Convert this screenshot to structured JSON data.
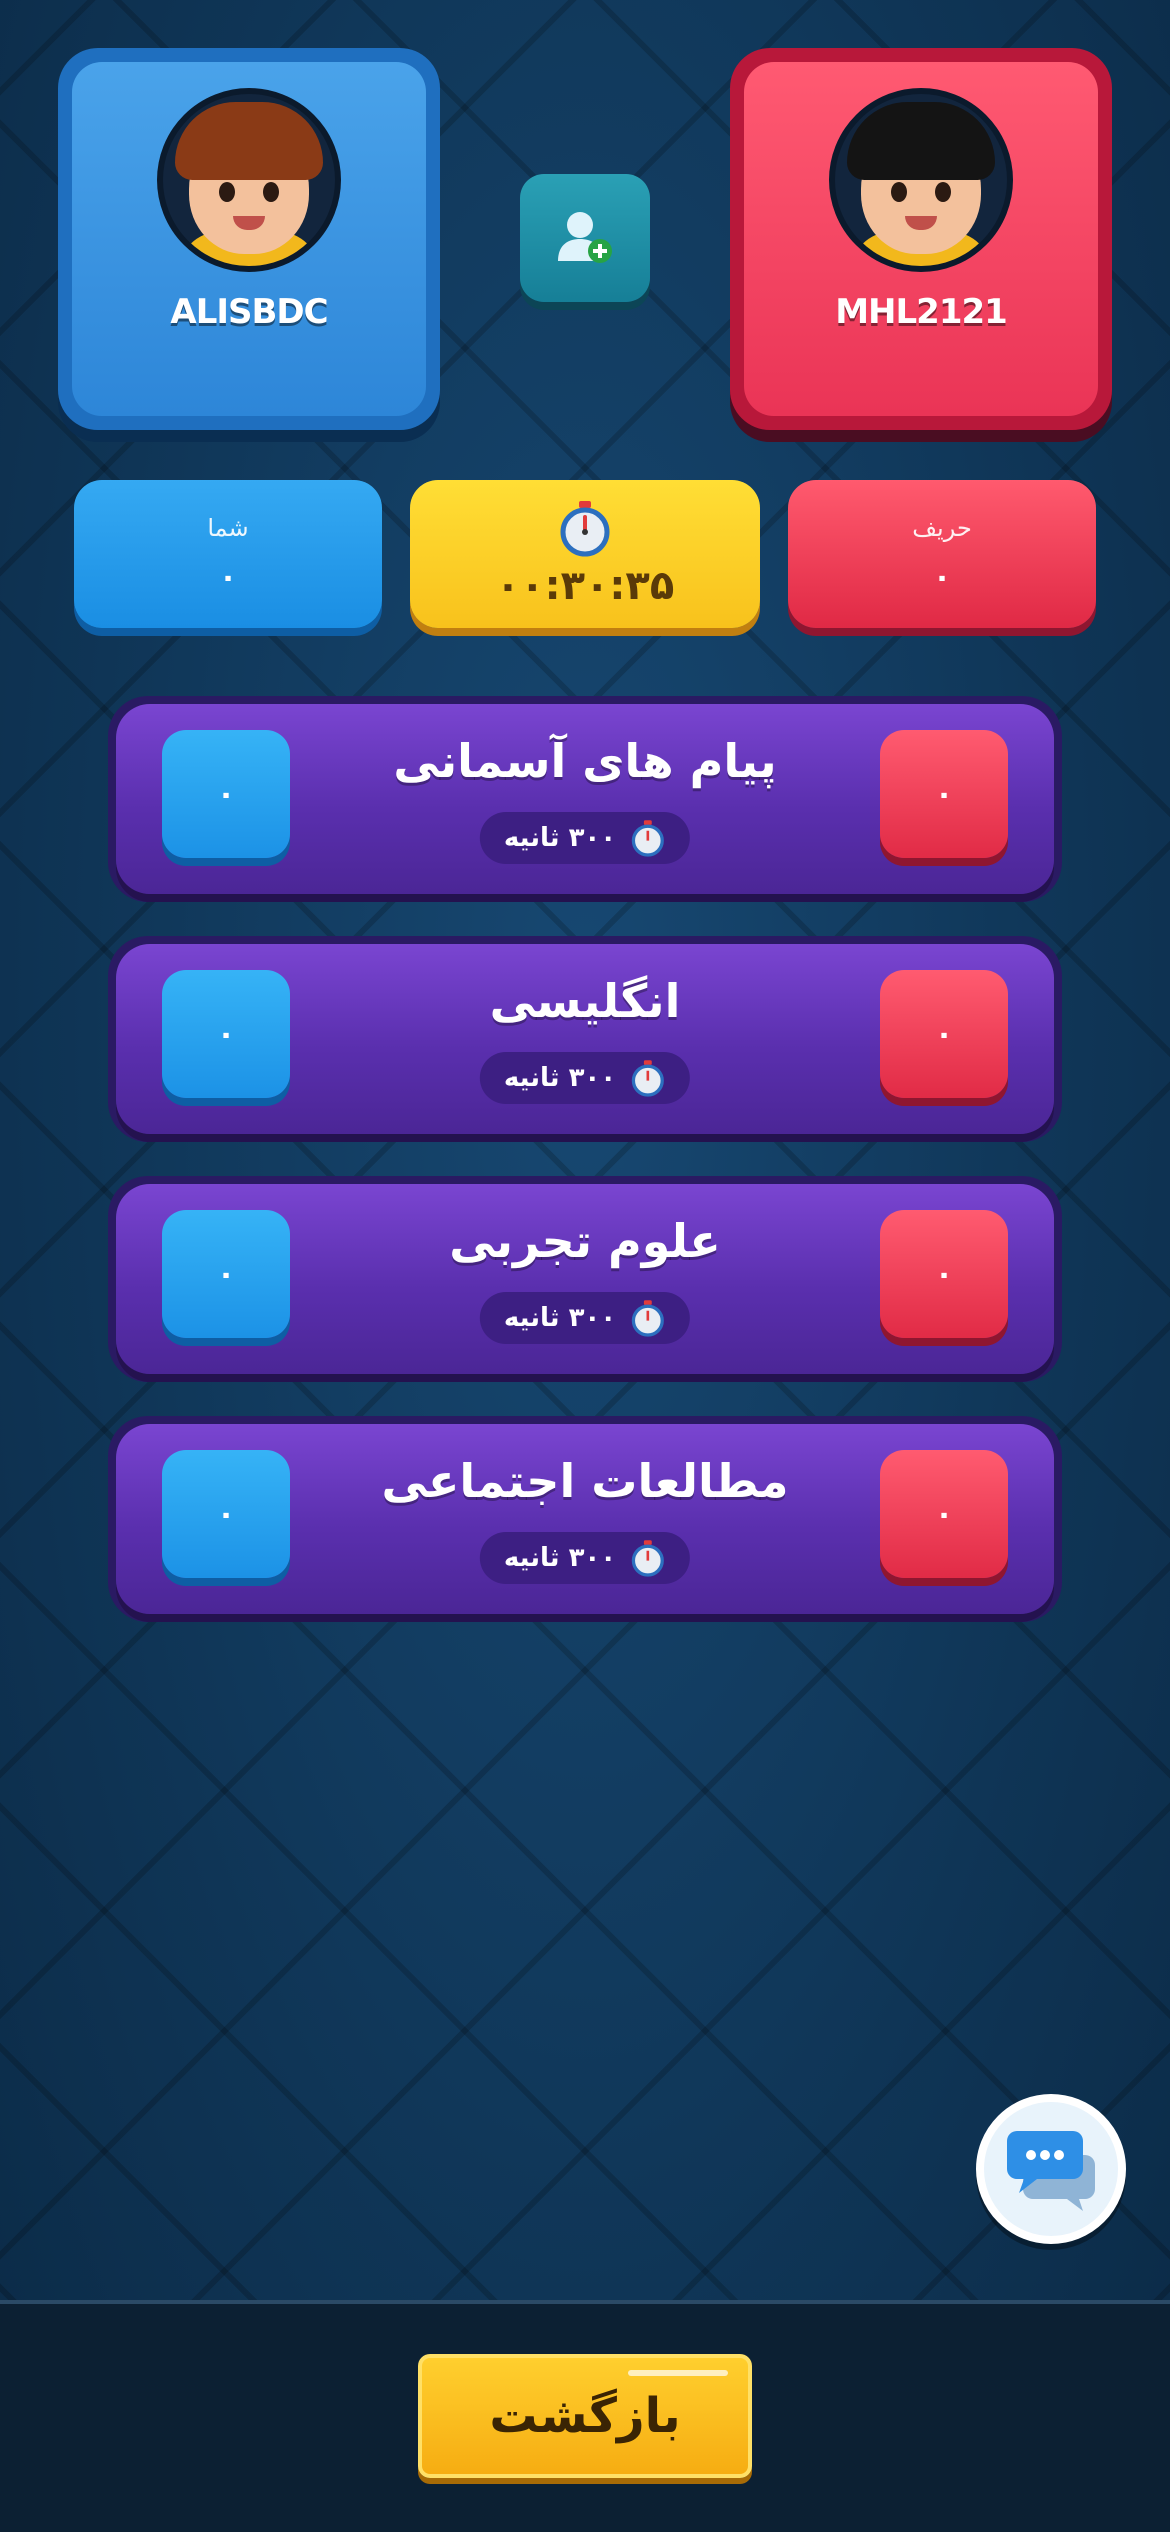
{
  "players": {
    "me": {
      "name": "ALISBDC",
      "score_label": "شما",
      "score": "۰"
    },
    "opponent": {
      "name": "MHL2121",
      "score_label": "حریف",
      "score": "۰"
    }
  },
  "timer": {
    "icon": "stopwatch-icon",
    "value": "۰۰:۳۰:۳۵"
  },
  "invite": {
    "icon": "add-friend-icon"
  },
  "categories": [
    {
      "title": "پیام های آسمانی",
      "time": "۳۰۰ ثانیه",
      "my_score": "۰",
      "opp_score": "۰"
    },
    {
      "title": "انگلیسی",
      "time": "۳۰۰ ثانیه",
      "my_score": "۰",
      "opp_score": "۰"
    },
    {
      "title": "علوم تجربی",
      "time": "۳۰۰ ثانیه",
      "my_score": "۰",
      "opp_score": "۰"
    },
    {
      "title": "مطالعات اجتماعی",
      "time": "۳۰۰ ثانیه",
      "my_score": "۰",
      "opp_score": "۰"
    }
  ],
  "chat": {
    "icon": "chat-bubbles-icon"
  },
  "footer": {
    "back_label": "بازگشت"
  },
  "colors": {
    "me": "#2d86d8",
    "opponent": "#ea3456",
    "category": "#5a2fae",
    "timer": "#f8c21c",
    "back": "#f6ad12"
  }
}
